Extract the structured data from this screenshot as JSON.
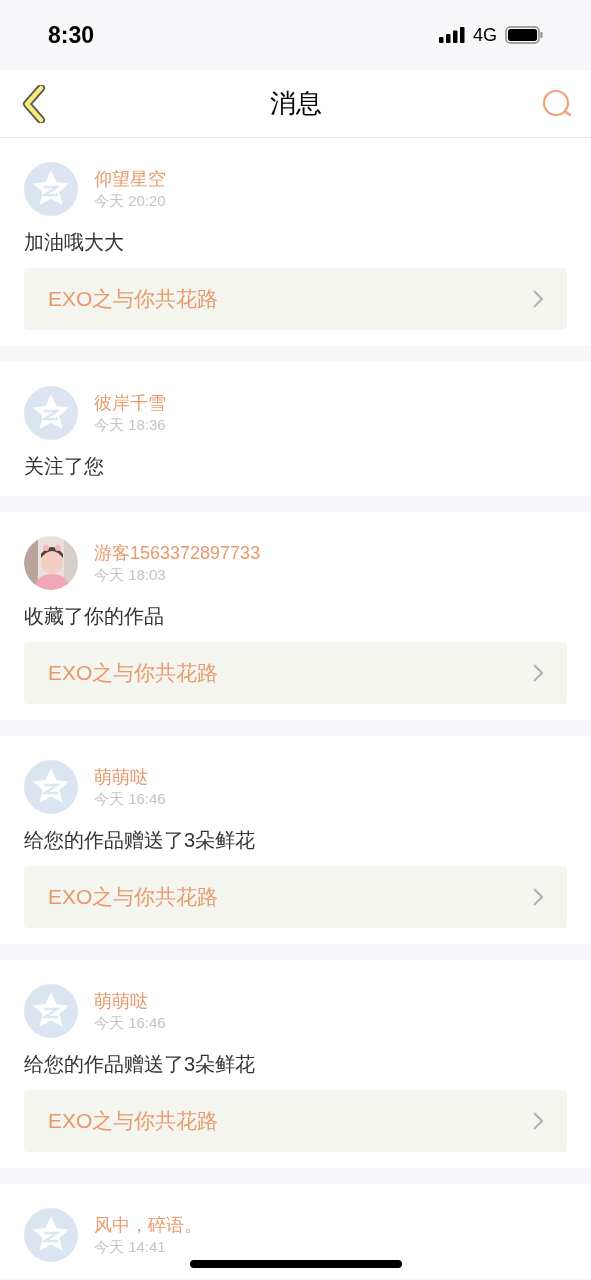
{
  "status_bar": {
    "time": "8:30",
    "network": "4G"
  },
  "nav": {
    "title": "消息"
  },
  "messages": [
    {
      "avatar": {
        "kind": "default"
      },
      "name": "仰望星空",
      "time": "今天 20:20",
      "text": "加油哦大大",
      "link": "EXO之与你共花路"
    },
    {
      "avatar": {
        "kind": "default"
      },
      "name": "彼岸千雪",
      "time": "今天 18:36",
      "text": "关注了您"
    },
    {
      "name": "游客1563372897733",
      "time": "今天 18:03",
      "text": "收藏了你的作品",
      "link": "EXO之与你共花路"
    },
    {
      "avatar": {
        "kind": "default"
      },
      "name": "萌萌哒",
      "time": "今天 16:46",
      "text": "给您的作品赠送了3朵鲜花",
      "link": "EXO之与你共花路"
    },
    {
      "avatar": {
        "kind": "default"
      },
      "name": "萌萌哒",
      "time": "今天 16:46",
      "text": "给您的作品赠送了3朵鲜花",
      "link": "EXO之与你共花路"
    },
    {
      "avatar": {
        "kind": "default"
      },
      "name": "风中，碎语。",
      "time": "今天 14:41"
    }
  ]
}
